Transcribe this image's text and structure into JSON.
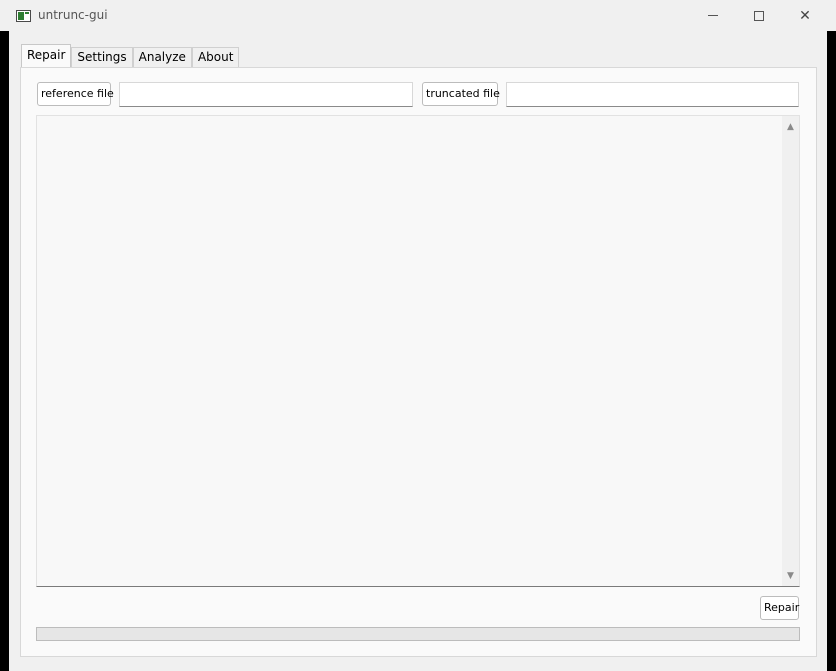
{
  "window": {
    "title": "untrunc-gui",
    "controls": {
      "minimize": "—",
      "maximize": "☐",
      "close": "✕"
    }
  },
  "tabs": [
    {
      "label": "Repair",
      "active": true
    },
    {
      "label": "Settings",
      "active": false
    },
    {
      "label": "Analyze",
      "active": false
    },
    {
      "label": "About",
      "active": false
    }
  ],
  "repair": {
    "reference_button": "reference file",
    "reference_value": "",
    "truncated_button": "truncated file",
    "truncated_value": "",
    "log_text": "",
    "scroll_up": "▲",
    "scroll_down": "▼",
    "repair_button": "Repair",
    "progress": 0
  },
  "colors": {
    "background": "#f0f0f0",
    "panel": "#fafafa",
    "progress_fill": "#06b025"
  }
}
